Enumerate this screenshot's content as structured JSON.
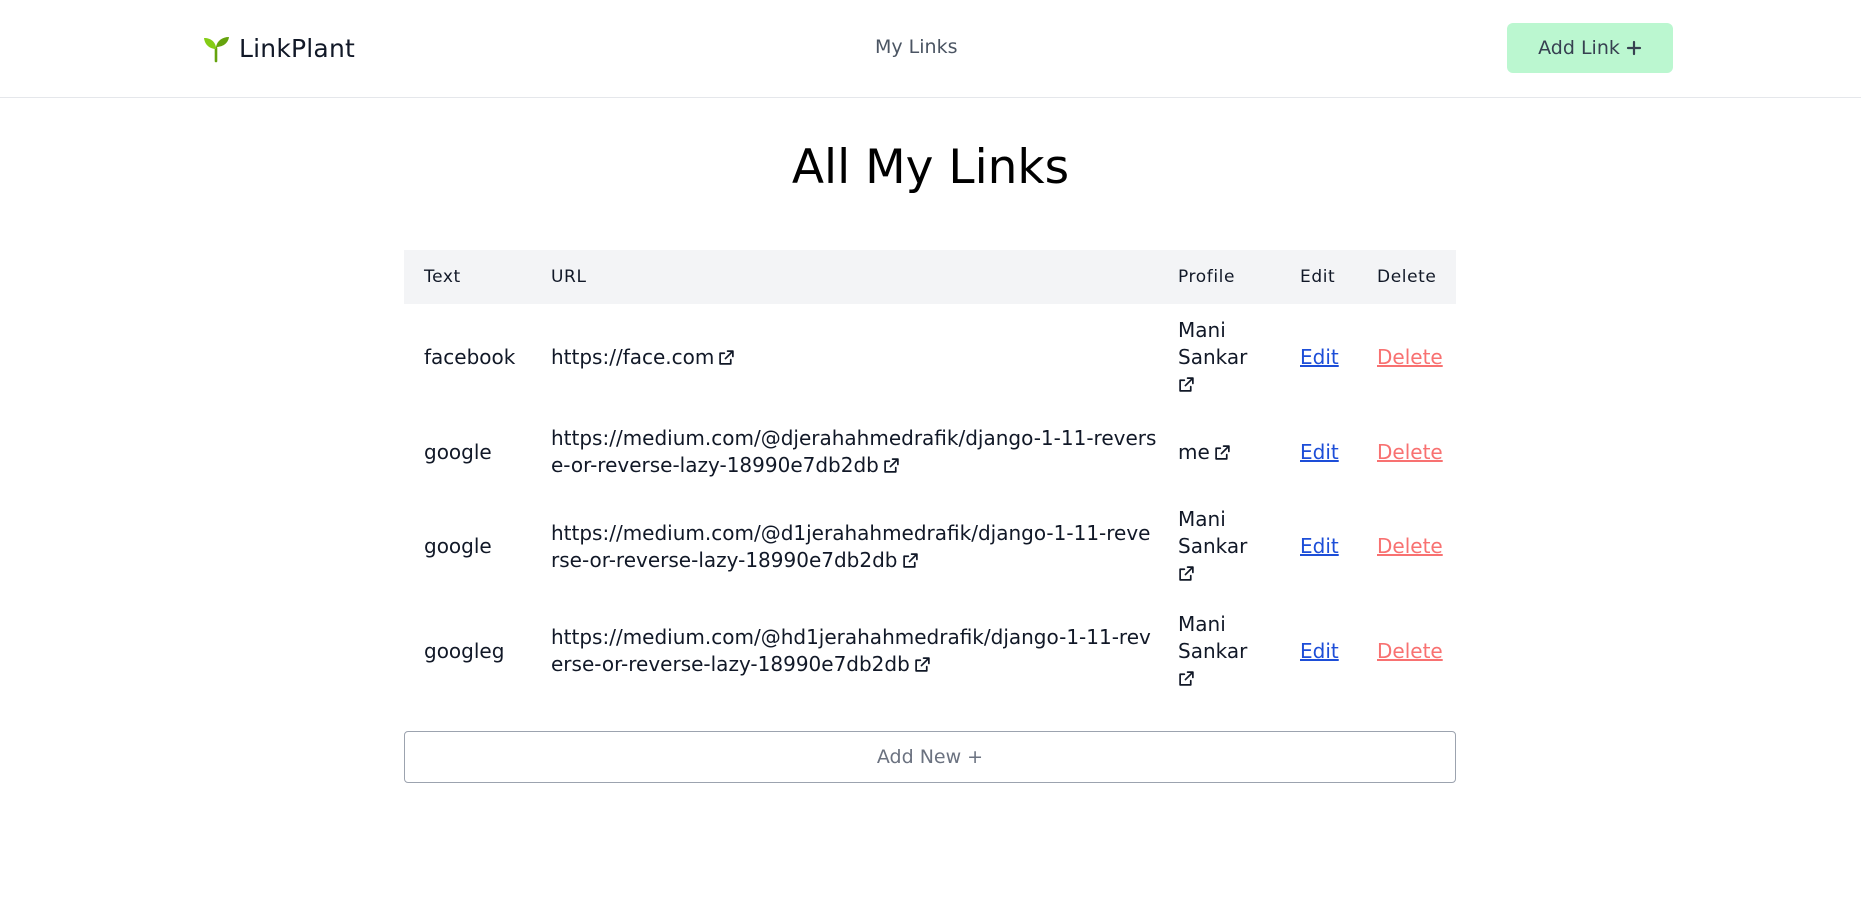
{
  "header": {
    "brand_name": "LinkPlant",
    "nav_label": "My Links",
    "add_link_label": "Add Link"
  },
  "icons": {
    "brand": "sprout-icon",
    "add": "plus-icon",
    "external": "external-link-icon"
  },
  "colors": {
    "add_button_bg": "#bbf7d0",
    "edit_link": "#1d4ed8",
    "delete_link": "#f87171",
    "table_header_bg": "#f3f4f6"
  },
  "main": {
    "title": "All My Links",
    "table": {
      "headers": [
        "Text",
        "URL",
        "Profile",
        "Edit",
        "Delete"
      ],
      "rows": [
        {
          "text": "facebook",
          "url": "https://face.com",
          "profile": "Mani Sankar",
          "edit": "Edit",
          "delete": "Delete"
        },
        {
          "text": "google",
          "url": "https://medium.com/@djerahahmedrafik/django-1-11-reverse-or-reverse-lazy-18990e7db2db",
          "profile": "me",
          "edit": "Edit",
          "delete": "Delete"
        },
        {
          "text": "google",
          "url": "https://medium.com/@d1jerahahmedrafik/django-1-11-reverse-or-reverse-lazy-18990e7db2db",
          "profile": "Mani Sankar",
          "edit": "Edit",
          "delete": "Delete"
        },
        {
          "text": "googleg",
          "url": "https://medium.com/@hd1jerahahmedrafik/django-1-11-reverse-or-reverse-lazy-18990e7db2db",
          "profile": "Mani Sankar",
          "edit": "Edit",
          "delete": "Delete"
        }
      ]
    },
    "add_new_label": "Add New +"
  }
}
